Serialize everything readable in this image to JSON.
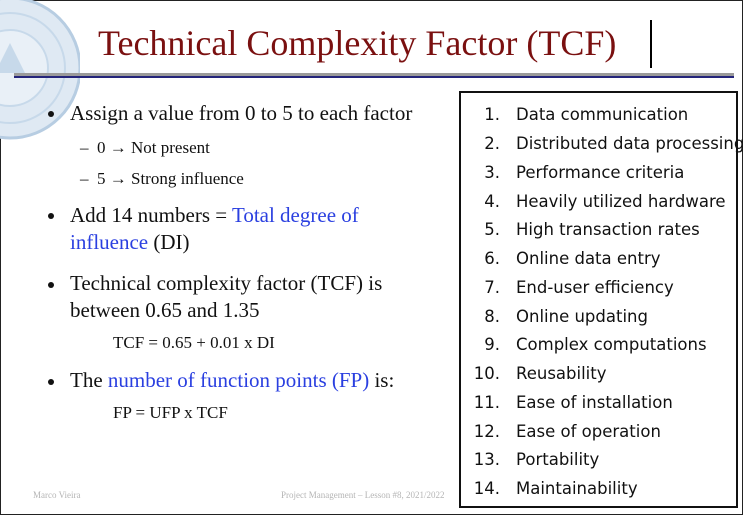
{
  "slide": {
    "title": "Technical Complexity Factor (TCF)",
    "bullets": [
      {
        "text": "Assign a value from 0 to 5 to each factor"
      },
      {
        "text_pre": "Add 14 numbers = ",
        "text_highlight": "Total degree of influence",
        "text_post": " (DI)"
      },
      {
        "text": "Technical complexity factor (TCF) is between 0.65 and 1.35"
      },
      {
        "text_pre": "The ",
        "text_highlight": "number of function points (FP)",
        "text_post": " is:"
      }
    ],
    "sub_items": [
      "0 → Not present",
      "5 → Strong influence"
    ],
    "formulas": [
      "TCF = 0.65 + 0.01 x DI",
      "FP = UFP x TCF"
    ],
    "factors": [
      {
        "num": "1.",
        "label": "Data communication"
      },
      {
        "num": "2.",
        "label": "Distributed data processing"
      },
      {
        "num": "3.",
        "label": "Performance criteria"
      },
      {
        "num": "4.",
        "label": "Heavily utilized hardware"
      },
      {
        "num": "5.",
        "label": "High transaction rates"
      },
      {
        "num": "6.",
        "label": "Online data entry"
      },
      {
        "num": "7.",
        "label": "End-user efficiency"
      },
      {
        "num": "8.",
        "label": "Online updating"
      },
      {
        "num": "9.",
        "label": "Complex computations"
      },
      {
        "num": "10.",
        "label": "Reusability"
      },
      {
        "num": "11.",
        "label": "Ease of installation"
      },
      {
        "num": "12.",
        "label": "Ease of operation"
      },
      {
        "num": "13.",
        "label": "Portability"
      },
      {
        "num": "14.",
        "label": "Maintainability"
      }
    ],
    "footer": {
      "author": "Marco Vieira",
      "course": "Project Management – Lesson #8, 2021/2022"
    },
    "colors": {
      "title": "#7a1010",
      "highlight": "#2a3fe0",
      "rule": "#24247a"
    }
  }
}
